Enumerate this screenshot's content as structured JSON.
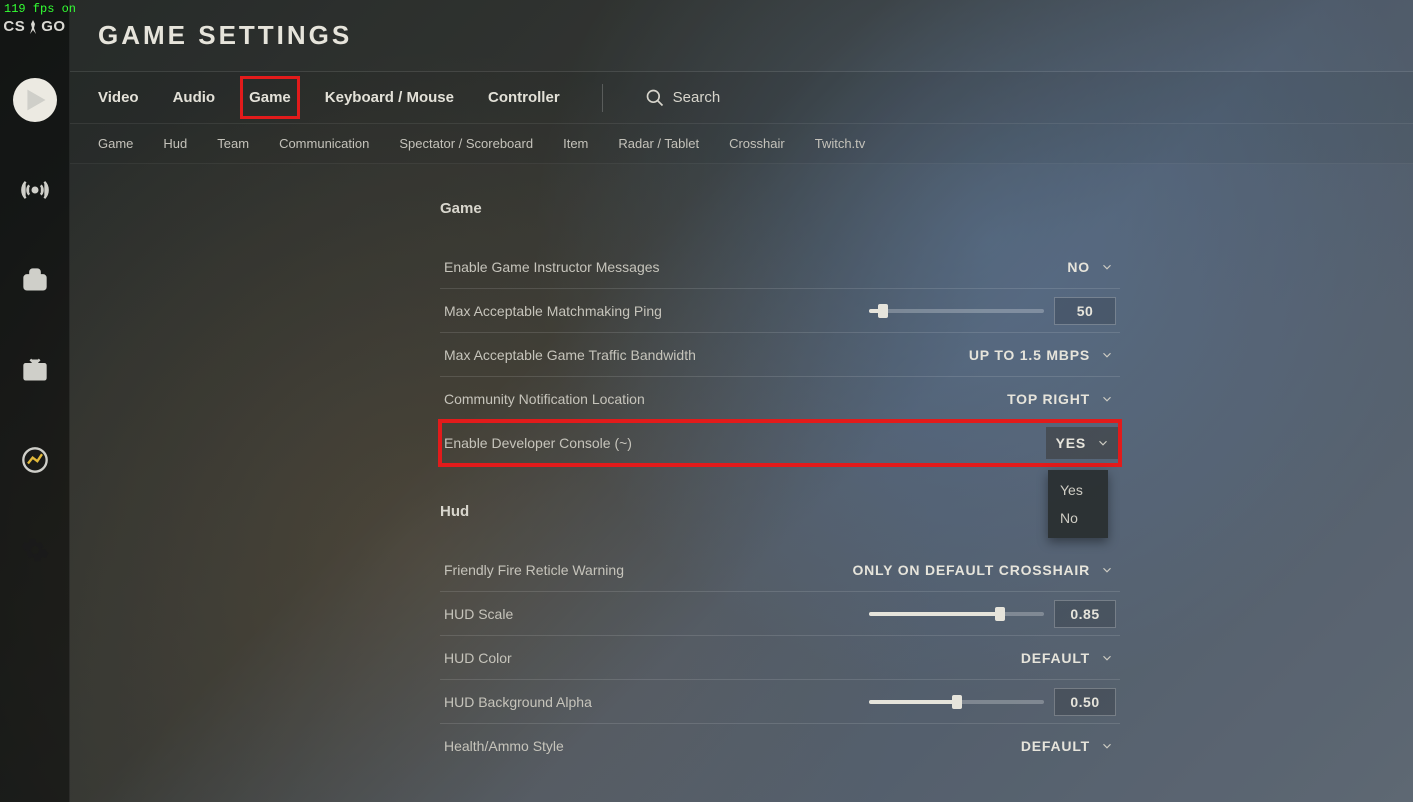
{
  "fps_overlay": "119 fps on",
  "logo": {
    "left": "CS",
    "right": "GO"
  },
  "page_title": "GAME SETTINGS",
  "tabs_primary": {
    "video": "Video",
    "audio": "Audio",
    "game": "Game",
    "keyboard": "Keyboard / Mouse",
    "controller": "Controller",
    "active": "game"
  },
  "search": {
    "placeholder": "Search"
  },
  "tabs_secondary": [
    "Game",
    "Hud",
    "Team",
    "Communication",
    "Spectator / Scoreboard",
    "Item",
    "Radar / Tablet",
    "Crosshair",
    "Twitch.tv"
  ],
  "sections": {
    "game": {
      "title": "Game",
      "rows": {
        "instructor": {
          "label": "Enable Game Instructor Messages",
          "value": "NO"
        },
        "mm_ping": {
          "label": "Max Acceptable Matchmaking Ping",
          "value": "50",
          "slider_pct": 8
        },
        "bandwidth": {
          "label": "Max Acceptable Game Traffic Bandwidth",
          "value": "UP TO 1.5 MBPS"
        },
        "notif_loc": {
          "label": "Community Notification Location",
          "value": "TOP RIGHT"
        },
        "dev_console": {
          "label": "Enable Developer Console (~)",
          "value": "YES",
          "options": [
            "Yes",
            "No"
          ]
        }
      }
    },
    "hud": {
      "title": "Hud",
      "rows": {
        "ff_warn": {
          "label": "Friendly Fire Reticle Warning",
          "value": "ONLY ON DEFAULT CROSSHAIR"
        },
        "scale": {
          "label": "HUD Scale",
          "value": "0.85",
          "slider_pct": 75
        },
        "color": {
          "label": "HUD Color",
          "value": "DEFAULT"
        },
        "bg_alpha": {
          "label": "HUD Background Alpha",
          "value": "0.50",
          "slider_pct": 50
        },
        "ha_style": {
          "label": "Health/Ammo Style",
          "value": "DEFAULT"
        }
      }
    }
  }
}
